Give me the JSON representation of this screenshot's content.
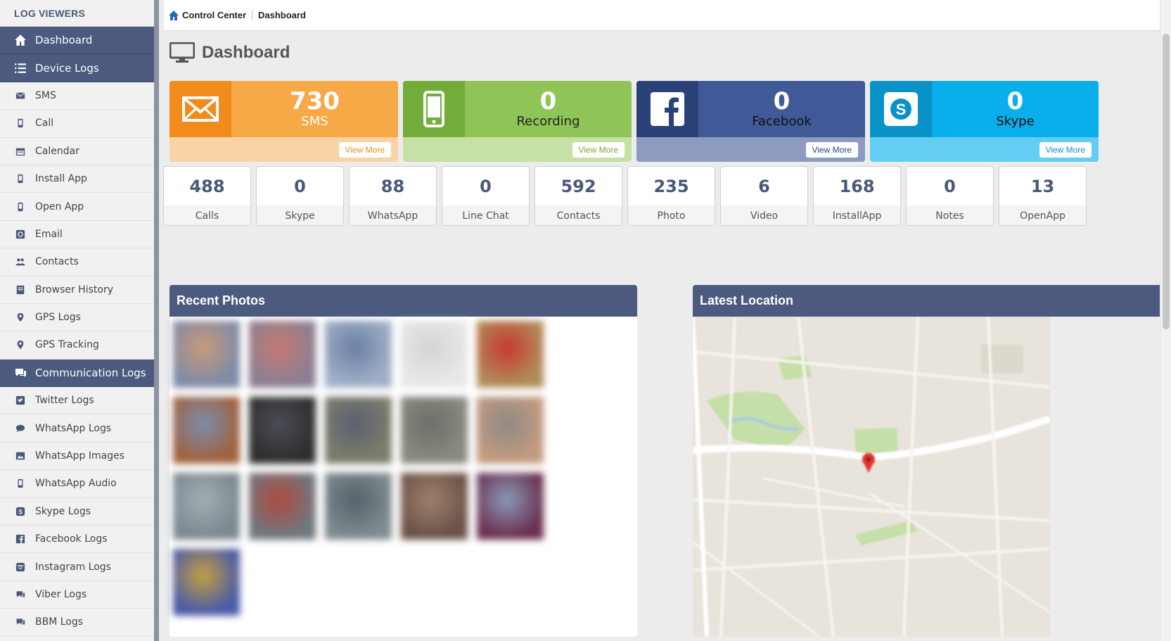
{
  "sidebar": {
    "brand": "LOG VIEWERS",
    "items": [
      {
        "label": "Dashboard",
        "icon": "home-icon",
        "section": true
      },
      {
        "label": "Device Logs",
        "icon": "list-icon",
        "section": true
      },
      {
        "label": "SMS",
        "icon": "envelope-icon"
      },
      {
        "label": "Call",
        "icon": "phone-icon"
      },
      {
        "label": "Calendar",
        "icon": "calendar-icon"
      },
      {
        "label": "Install App",
        "icon": "phone-icon"
      },
      {
        "label": "Open App",
        "icon": "phone-icon"
      },
      {
        "label": "Email",
        "icon": "at-icon"
      },
      {
        "label": "Contacts",
        "icon": "users-icon"
      },
      {
        "label": "Browser History",
        "icon": "book-icon"
      },
      {
        "label": "GPS Logs",
        "icon": "map-marker-icon"
      },
      {
        "label": "GPS Tracking",
        "icon": "map-marker-icon"
      },
      {
        "label": "Communication Logs",
        "icon": "comments-icon",
        "section": true
      },
      {
        "label": "Twitter Logs",
        "icon": "twitter-icon"
      },
      {
        "label": "WhatsApp Logs",
        "icon": "comment-icon"
      },
      {
        "label": "WhatsApp Images",
        "icon": "image-icon"
      },
      {
        "label": "WhatsApp Audio",
        "icon": "phone-icon"
      },
      {
        "label": "Skype Logs",
        "icon": "skype-icon"
      },
      {
        "label": "Facebook Logs",
        "icon": "facebook-icon"
      },
      {
        "label": "Instagram Logs",
        "icon": "instagram-icon"
      },
      {
        "label": "Viber Logs",
        "icon": "comments-icon"
      },
      {
        "label": "BBM Logs",
        "icon": "comments-icon"
      }
    ]
  },
  "breadcrumb": {
    "root": "Control Center",
    "current": "Dashboard"
  },
  "page": {
    "title": "Dashboard"
  },
  "cards": {
    "sms": {
      "value": "730",
      "label": "SMS",
      "button": "View More",
      "icon": "envelope-icon"
    },
    "recording": {
      "value": "0",
      "label": "Recording",
      "button": "View More",
      "icon": "mobile-icon"
    },
    "facebook": {
      "value": "0",
      "label": "Facebook",
      "button": "View More",
      "icon": "facebook-icon"
    },
    "skype": {
      "value": "0",
      "label": "Skype",
      "button": "View More",
      "icon": "skype-icon"
    }
  },
  "stats": [
    {
      "value": "488",
      "label": "Calls"
    },
    {
      "value": "0",
      "label": "Skype"
    },
    {
      "value": "88",
      "label": "WhatsApp"
    },
    {
      "value": "0",
      "label": "Line Chat"
    },
    {
      "value": "592",
      "label": "Contacts"
    },
    {
      "value": "235",
      "label": "Photo"
    },
    {
      "value": "6",
      "label": "Video"
    },
    {
      "value": "168",
      "label": "InstallApp"
    },
    {
      "value": "0",
      "label": "Notes"
    },
    {
      "value": "13",
      "label": "OpenApp"
    }
  ],
  "panels": {
    "photos": {
      "title": "Recent Photos"
    },
    "location": {
      "title": "Latest Location"
    }
  },
  "colors": {
    "accent_navy": "#4b5a7e",
    "sms_orange": "#f7a847",
    "recording_green": "#8fc556",
    "facebook_blue": "#3f5a96",
    "skype_cyan": "#0aaeeb"
  }
}
